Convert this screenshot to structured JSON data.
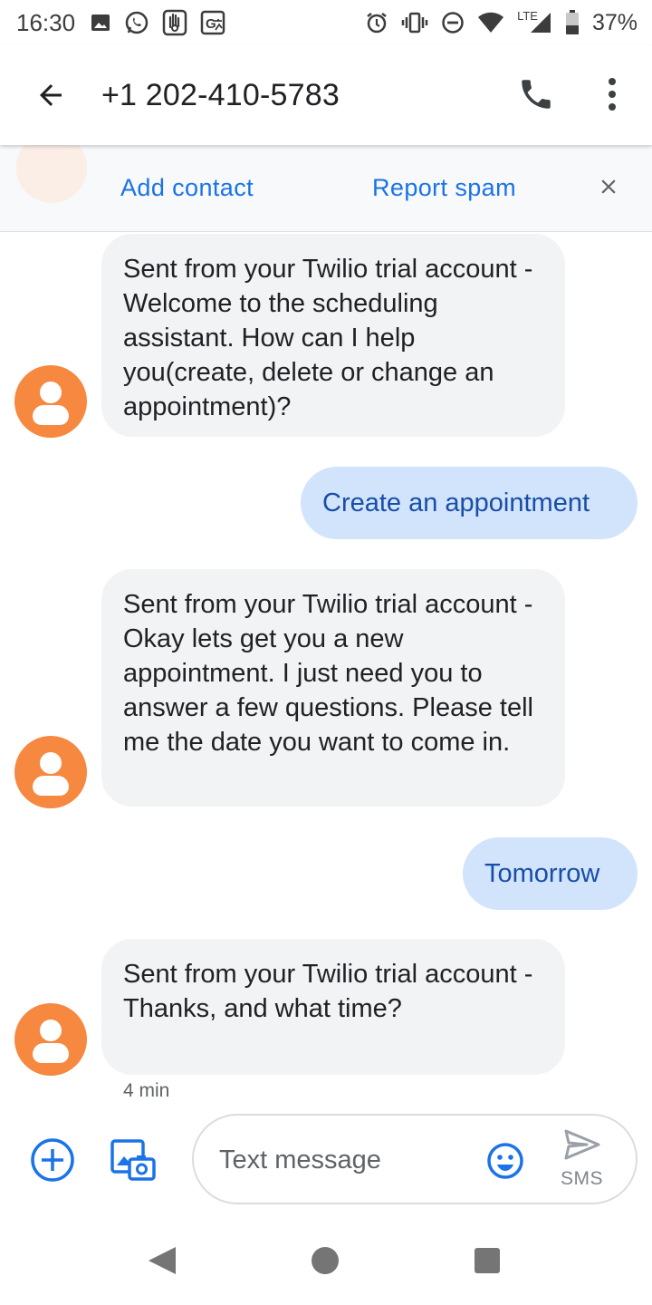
{
  "status_bar": {
    "time": "16:30",
    "network": "LTE",
    "battery": "37%",
    "icons": [
      "image-icon",
      "whatsapp-icon",
      "hand-icon",
      "translate-icon",
      "alarm-icon",
      "vibrate-icon",
      "dnd-icon",
      "wifi-icon",
      "signal-icon",
      "battery-icon"
    ]
  },
  "header": {
    "title": "+1 202-410-5783",
    "back_icon": "arrow-back-icon",
    "call_icon": "phone-icon",
    "more_icon": "more-vert-icon"
  },
  "actions": {
    "add_contact": "Add contact",
    "report_spam": "Report spam",
    "close_icon": "close-icon"
  },
  "messages": [
    {
      "direction": "incoming",
      "text": "Sent from your Twilio trial account - Welcome to the scheduling assistant. How can I help you(create, delete or change an appointment)?"
    },
    {
      "direction": "outgoing",
      "text": "Create an appointment"
    },
    {
      "direction": "incoming",
      "text": "Sent from your Twilio trial account - Okay lets get you a new appointment. I just need you to answer a few questions. Please tell me the date you want to come in."
    },
    {
      "direction": "outgoing",
      "text": "Tomorrow"
    },
    {
      "direction": "incoming",
      "text": "Sent from your Twilio trial account - Thanks, and what time?"
    }
  ],
  "last_timestamp": "4 min",
  "compose": {
    "placeholder": "Text message",
    "send_label": "SMS"
  },
  "colors": {
    "accent": "#1a73e8",
    "avatar": "#f6883f",
    "incoming_bubble": "#f1f3f4",
    "outgoing_bubble": "#d2e3fc",
    "outgoing_text": "#174ea6"
  }
}
